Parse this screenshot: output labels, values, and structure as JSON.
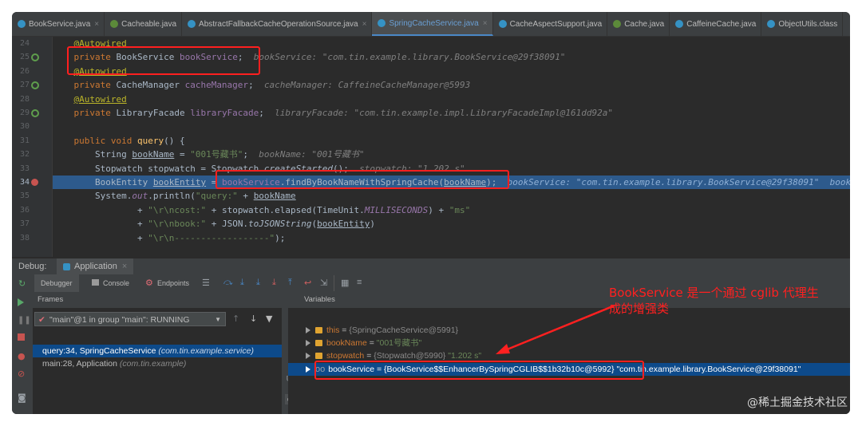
{
  "tabs": [
    {
      "label": "BookService.java",
      "kind": "c",
      "active": false
    },
    {
      "label": "Cacheable.java",
      "kind": "g",
      "active": false
    },
    {
      "label": "AbstractFallbackCacheOperationSource.java",
      "kind": "c",
      "active": false
    },
    {
      "label": "SpringCacheService.java",
      "kind": "c",
      "active": true
    },
    {
      "label": "CacheAspectSupport.java",
      "kind": "c",
      "active": false
    },
    {
      "label": "Cache.java",
      "kind": "g",
      "active": false
    },
    {
      "label": "CaffeineCache.java",
      "kind": "c",
      "active": false
    },
    {
      "label": "ObjectUtils.class",
      "kind": "c",
      "active": false
    }
  ],
  "line_numbers": [
    "24",
    "25",
    "26",
    "27",
    "28",
    "29",
    "30",
    "31",
    "32",
    "33",
    "34",
    "35",
    "36",
    "37",
    "38"
  ],
  "code": {
    "l24_ann": "@Autowired",
    "l25_kw": "private ",
    "l25_type": "BookService ",
    "l25_name": "bookService",
    "l25_semi": ";",
    "l25_hint": "bookService: \"com.tin.example.library.BookService@29f38091\"",
    "l26_ann": "@Autowired",
    "l27_kw": "private ",
    "l27_type": "CacheManager ",
    "l27_name": "cacheManager",
    "l27_semi": ";",
    "l27_hint": "cacheManager: CaffeineCacheManager@5993",
    "l28_ann": "@Autowired",
    "l29_kw": "private ",
    "l29_type": "LibraryFacade ",
    "l29_name": "libraryFacade",
    "l29_semi": ";",
    "l29_hint": "libraryFacade: \"com.tin.example.impl.LibraryFacadeImpl@161dd92a\"",
    "l31_kw": "public void ",
    "l31_mth": "query",
    "l31_rest": "() {",
    "l32_type": "String ",
    "l32_var": "bookName",
    "l32_eq": " = ",
    "l32_str": "\"001号藏书\"",
    "l32_semi": ";",
    "l32_hint": "bookName: \"001号藏书\"",
    "l33_a": "Stopwatch stopwatch = Stopwatch.",
    "l33_m": "createStarted",
    "l33_b": "();",
    "l33_hint": "stopwatch: \"1.202 s\"",
    "l34_type": "BookEntity ",
    "l34_var": "bookEntity",
    "l34_eq": " = ",
    "l34_fld": "bookService",
    "l34_call": ".findByBookNameWithSpringCache(",
    "l34_arg": "bookName",
    "l34_end": ");",
    "l34_hint": "bookService: \"com.tin.example.library.BookService@29f38091\"  book",
    "l35_a": "System.",
    "l35_out": "out",
    "l35_b": ".println(",
    "l35_str": "\"query:\"",
    "l35_c": " + ",
    "l35_var": "bookName",
    "l36_a": "+ ",
    "l36_s1": "\"\\r\\ncost:\"",
    "l36_b": " + stopwatch.elapsed(TimeUnit.",
    "l36_st": "MILLISECONDS",
    "l36_c": ") + ",
    "l36_s2": "\"ms\"",
    "l37_a": "+ ",
    "l37_s1": "\"\\r\\nbook:\"",
    "l37_b": " + JSON.",
    "l37_m": "toJSONString",
    "l37_c": "(",
    "l37_var": "bookEntity",
    "l37_d": ")",
    "l38_a": "+ ",
    "l38_s1": "\"\\r\\n------------------\"",
    "l38_b": ");"
  },
  "debug": {
    "label": "Debug:",
    "config": "Application",
    "tabs": {
      "debugger": "Debugger",
      "console": "Console",
      "endpoints": "Endpoints"
    }
  },
  "frames": {
    "header": "Frames",
    "thread": "\"main\"@1 in group \"main\": RUNNING",
    "items": [
      {
        "method": "query:34, SpringCacheService",
        "cls": "(com.tin.example.service)"
      },
      {
        "method": "main:28, Application",
        "cls": "(com.tin.example)"
      }
    ]
  },
  "variables": {
    "header": "Variables",
    "items": [
      {
        "name": "this",
        "eq": " = ",
        "type": "{SpringCacheService@5991}",
        "value": ""
      },
      {
        "name": "bookName",
        "eq": " = ",
        "type": "",
        "value": "\"001号藏书\""
      },
      {
        "name": "stopwatch",
        "eq": " = ",
        "type": "{Stopwatch@5990}",
        "value": " \"1.202 s\""
      },
      {
        "name": "bookService",
        "eq": " = ",
        "type": "{BookService$$EnhancerBySpringCGLIB$$1b32b10c@5992}",
        "value": " \"com.tin.example.library.BookService@29f38091\""
      }
    ]
  },
  "annotation": {
    "callout": "BookService 是一个通过 cglib 代理生成的增强类",
    "color": "#ff2020"
  },
  "watermark": "@稀土掘金技术社区"
}
